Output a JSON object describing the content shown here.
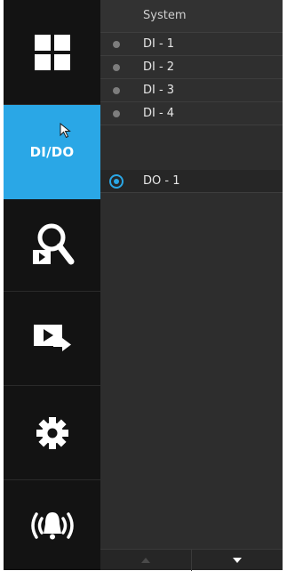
{
  "panel": {
    "header_label": "System",
    "channels": [
      {
        "label": "DI - 1",
        "selected": false
      },
      {
        "label": "DI - 2",
        "selected": false
      },
      {
        "label": "DI - 3",
        "selected": false
      },
      {
        "label": "DI - 4",
        "selected": false
      },
      {
        "label": "DO - 1",
        "selected": true
      }
    ]
  },
  "sidebar": {
    "items": [
      {
        "icon": "layout-grid-icon"
      },
      {
        "label": "DI/DO",
        "icon": "cursor-arrow-icon",
        "active": true
      },
      {
        "icon": "search-playback-icon"
      },
      {
        "icon": "export-video-icon"
      },
      {
        "icon": "gear-icon"
      },
      {
        "icon": "alarm-bell-icon"
      }
    ]
  },
  "footer": {
    "up_icon": "chevron-up-icon",
    "down_icon": "chevron-down-icon"
  },
  "colors": {
    "accent": "#2aa7e6",
    "sidebar_bg": "#131313",
    "panel_bg": "#2d2d2d",
    "inactive_dot": "#7d7d7d"
  }
}
